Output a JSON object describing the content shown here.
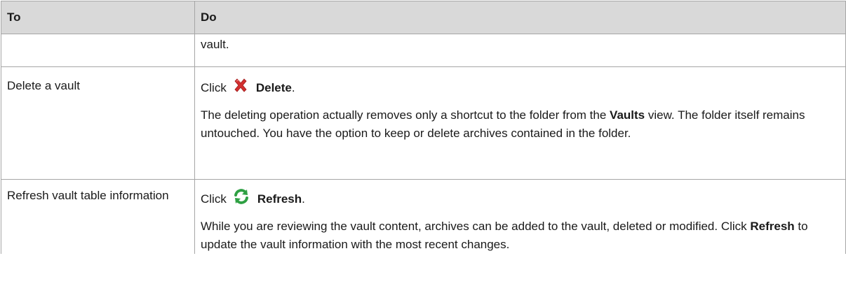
{
  "header": {
    "col1": "To",
    "col2": "Do"
  },
  "rows": [
    {
      "to": "",
      "do_continuation": "vault."
    },
    {
      "to": "Delete a vault",
      "click_prefix": "Click",
      "action_label": "Delete",
      "action_suffix": ".",
      "icon": "delete-x-icon",
      "para_part1": "The deleting operation actually removes only a shortcut to the folder from the ",
      "para_bold": "Vaults",
      "para_part2": " view. The folder itself remains untouched. You have the option to keep or delete archives contained in the folder."
    },
    {
      "to": "Refresh vault table information",
      "click_prefix": "Click",
      "action_label": "Refresh",
      "action_suffix": ".",
      "icon": "refresh-icon",
      "para_part1": "While you are reviewing the vault content, archives can be added to the vault, deleted or modified. Click ",
      "para_bold": "Refresh",
      "para_part2": " to update the vault information with the most recent changes."
    }
  ],
  "colors": {
    "header_bg": "#d9d9d9",
    "border": "#a6a6a6",
    "delete_icon": "#d32f2f",
    "refresh_icon": "#2ea043"
  }
}
